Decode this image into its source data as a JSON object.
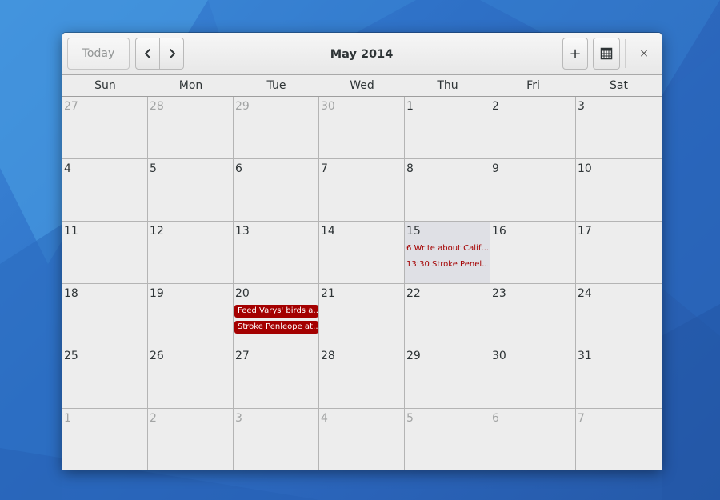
{
  "colors": {
    "event": "#a40000",
    "today_bg": "#dfe0e5",
    "desktop": "#2f72c8"
  },
  "toolbar": {
    "today_label": "Today",
    "prev_icon": "go-previous-icon",
    "next_icon": "go-next-icon",
    "title": "May 2014",
    "add_label": "+",
    "view_icon": "calendar-month-icon",
    "close_label": "×"
  },
  "day_names": [
    "Sun",
    "Mon",
    "Tue",
    "Wed",
    "Thu",
    "Fri",
    "Sat"
  ],
  "weeks": [
    [
      {
        "day": "27",
        "other": true
      },
      {
        "day": "28",
        "other": true
      },
      {
        "day": "29",
        "other": true
      },
      {
        "day": "30",
        "other": true
      },
      {
        "day": "1"
      },
      {
        "day": "2"
      },
      {
        "day": "3"
      }
    ],
    [
      {
        "day": "4"
      },
      {
        "day": "5"
      },
      {
        "day": "6"
      },
      {
        "day": "7"
      },
      {
        "day": "8"
      },
      {
        "day": "9"
      },
      {
        "day": "10"
      }
    ],
    [
      {
        "day": "11"
      },
      {
        "day": "12"
      },
      {
        "day": "13"
      },
      {
        "day": "14"
      },
      {
        "day": "15",
        "today": true,
        "events": [
          {
            "text": "6 Write about Calif…",
            "style": "text"
          },
          {
            "text": "13:30 Stroke Penel…",
            "style": "text"
          }
        ]
      },
      {
        "day": "16"
      },
      {
        "day": "17"
      }
    ],
    [
      {
        "day": "18"
      },
      {
        "day": "19"
      },
      {
        "day": "20",
        "events": [
          {
            "text": "Feed Varys' birds a…",
            "style": "pill"
          },
          {
            "text": "Stroke Penleope at…",
            "style": "pill"
          }
        ]
      },
      {
        "day": "21"
      },
      {
        "day": "22"
      },
      {
        "day": "23"
      },
      {
        "day": "24"
      }
    ],
    [
      {
        "day": "25"
      },
      {
        "day": "26"
      },
      {
        "day": "27"
      },
      {
        "day": "28"
      },
      {
        "day": "29"
      },
      {
        "day": "30"
      },
      {
        "day": "31"
      }
    ],
    [
      {
        "day": "1",
        "other": true
      },
      {
        "day": "2",
        "other": true
      },
      {
        "day": "3",
        "other": true
      },
      {
        "day": "4",
        "other": true
      },
      {
        "day": "5",
        "other": true
      },
      {
        "day": "6",
        "other": true
      },
      {
        "day": "7",
        "other": true
      }
    ]
  ]
}
